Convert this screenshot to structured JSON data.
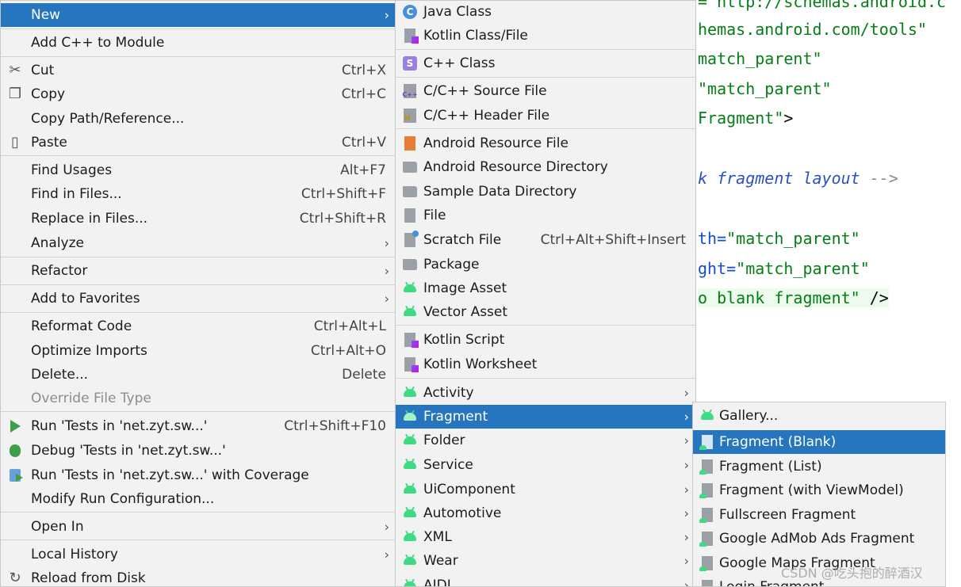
{
  "editor": {
    "lines": [
      {
        "parts": [
          {
            "t": "= http://schemas.android.c",
            "c": "c-str"
          }
        ]
      },
      {
        "parts": [
          {
            "t": "hemas.android.com/tools\"",
            "c": "c-str"
          }
        ]
      },
      {
        "parts": [
          {
            "t": "match_parent\"",
            "c": "c-str"
          }
        ]
      },
      {
        "parts": [
          {
            "t": "\"match_parent\"",
            "c": "c-str"
          }
        ]
      },
      {
        "parts": [
          {
            "t": "Fragment\"",
            "c": "c-str"
          },
          {
            "t": ">",
            "c": "c-plain"
          }
        ]
      },
      {
        "parts": [
          {
            "t": "k fragment layout",
            "c": "c-comi"
          },
          {
            "t": " -->",
            "c": "c-com"
          }
        ]
      },
      {
        "parts": [
          {
            "t": "th=",
            "c": "c-attr"
          },
          {
            "t": "\"match_parent\"",
            "c": "c-str"
          }
        ]
      },
      {
        "parts": [
          {
            "t": "ght=",
            "c": "c-attr"
          },
          {
            "t": "\"match_parent\"",
            "c": "c-str"
          }
        ]
      },
      {
        "parts": [
          {
            "t": "o blank fragment\"",
            "c": "c-str"
          },
          {
            "t": " />",
            "c": "c-plain"
          }
        ]
      }
    ]
  },
  "menu1": {
    "items": [
      {
        "label": "New",
        "shortcut": "",
        "submenu": true,
        "selected": true,
        "icon": ""
      },
      {
        "label": "Add C++ to Module",
        "shortcut": "",
        "submenu": false,
        "icon": ""
      },
      {
        "label": "Cut",
        "shortcut": "Ctrl+X",
        "submenu": false,
        "icon": "scissors-icon"
      },
      {
        "label": "Copy",
        "shortcut": "Ctrl+C",
        "submenu": false,
        "icon": "copy-icon"
      },
      {
        "label": "Copy Path/Reference...",
        "shortcut": "",
        "submenu": false,
        "icon": ""
      },
      {
        "label": "Paste",
        "shortcut": "Ctrl+V",
        "submenu": false,
        "icon": "clipboard-icon"
      },
      {
        "label": "Find Usages",
        "shortcut": "Alt+F7",
        "submenu": false,
        "icon": ""
      },
      {
        "label": "Find in Files...",
        "shortcut": "Ctrl+Shift+F",
        "submenu": false,
        "icon": ""
      },
      {
        "label": "Replace in Files...",
        "shortcut": "Ctrl+Shift+R",
        "submenu": false,
        "icon": ""
      },
      {
        "label": "Analyze",
        "shortcut": "",
        "submenu": true,
        "icon": ""
      },
      {
        "label": "Refactor",
        "shortcut": "",
        "submenu": true,
        "icon": ""
      },
      {
        "label": "Add to Favorites",
        "shortcut": "",
        "submenu": true,
        "icon": ""
      },
      {
        "label": "Reformat Code",
        "shortcut": "Ctrl+Alt+L",
        "submenu": false,
        "icon": ""
      },
      {
        "label": "Optimize Imports",
        "shortcut": "Ctrl+Alt+O",
        "submenu": false,
        "icon": ""
      },
      {
        "label": "Delete...",
        "shortcut": "Delete",
        "submenu": false,
        "icon": ""
      },
      {
        "label": "Override File Type",
        "shortcut": "",
        "submenu": false,
        "disabled": true,
        "icon": ""
      },
      {
        "label": "Run 'Tests in 'net.zyt.sw...'",
        "shortcut": "Ctrl+Shift+F10",
        "submenu": false,
        "icon": "run-icon"
      },
      {
        "label": "Debug 'Tests in 'net.zyt.sw...'",
        "shortcut": "",
        "submenu": false,
        "icon": "debug-icon"
      },
      {
        "label": "Run 'Tests in 'net.zyt.sw...' with Coverage",
        "shortcut": "",
        "submenu": false,
        "icon": "coverage-icon"
      },
      {
        "label": "Modify Run Configuration...",
        "shortcut": "",
        "submenu": false,
        "icon": ""
      },
      {
        "label": "Open In",
        "shortcut": "",
        "submenu": true,
        "icon": ""
      },
      {
        "label": "Local History",
        "shortcut": "",
        "submenu": true,
        "icon": ""
      },
      {
        "label": "Reload from Disk",
        "shortcut": "",
        "submenu": false,
        "icon": "reload-icon"
      }
    ]
  },
  "menu2": {
    "items": [
      {
        "label": "Java Class",
        "shortcut": "",
        "submenu": false,
        "icon": "java-class-icon"
      },
      {
        "label": "Kotlin Class/File",
        "shortcut": "",
        "submenu": false,
        "icon": "kotlin-file-icon"
      },
      {
        "label": "C++ Class",
        "shortcut": "",
        "submenu": false,
        "icon": "cpp-class-icon"
      },
      {
        "label": "C/C++ Source File",
        "shortcut": "",
        "submenu": false,
        "icon": "c-source-icon"
      },
      {
        "label": "C/C++ Header File",
        "shortcut": "",
        "submenu": false,
        "icon": "c-header-icon"
      },
      {
        "label": "Android Resource File",
        "shortcut": "",
        "submenu": false,
        "icon": "resource-file-icon"
      },
      {
        "label": "Android Resource Directory",
        "shortcut": "",
        "submenu": false,
        "icon": "folder-icon"
      },
      {
        "label": "Sample Data Directory",
        "shortcut": "",
        "submenu": false,
        "icon": "folder-icon"
      },
      {
        "label": "File",
        "shortcut": "",
        "submenu": false,
        "icon": "file-icon"
      },
      {
        "label": "Scratch File",
        "shortcut": "Ctrl+Alt+Shift+Insert",
        "submenu": false,
        "icon": "scratch-file-icon"
      },
      {
        "label": "Package",
        "shortcut": "",
        "submenu": false,
        "icon": "package-icon"
      },
      {
        "label": "Image Asset",
        "shortcut": "",
        "submenu": false,
        "icon": "android-icon"
      },
      {
        "label": "Vector Asset",
        "shortcut": "",
        "submenu": false,
        "icon": "android-icon"
      },
      {
        "label": "Kotlin Script",
        "shortcut": "",
        "submenu": false,
        "icon": "kotlin-file-icon"
      },
      {
        "label": "Kotlin Worksheet",
        "shortcut": "",
        "submenu": false,
        "icon": "kotlin-file-icon"
      },
      {
        "label": "Activity",
        "shortcut": "",
        "submenu": true,
        "icon": "android-icon"
      },
      {
        "label": "Fragment",
        "shortcut": "",
        "submenu": true,
        "selected": true,
        "icon": "android-icon"
      },
      {
        "label": "Folder",
        "shortcut": "",
        "submenu": true,
        "icon": "android-icon"
      },
      {
        "label": "Service",
        "shortcut": "",
        "submenu": true,
        "icon": "android-icon"
      },
      {
        "label": "UiComponent",
        "shortcut": "",
        "submenu": true,
        "icon": "android-icon"
      },
      {
        "label": "Automotive",
        "shortcut": "",
        "submenu": true,
        "icon": "android-icon"
      },
      {
        "label": "XML",
        "shortcut": "",
        "submenu": true,
        "icon": "android-icon"
      },
      {
        "label": "Wear",
        "shortcut": "",
        "submenu": true,
        "icon": "android-icon"
      },
      {
        "label": "AIDL",
        "shortcut": "",
        "submenu": true,
        "icon": "android-icon"
      }
    ]
  },
  "menu3": {
    "items": [
      {
        "label": "Gallery...",
        "icon": "android-icon"
      },
      {
        "label": "Fragment (Blank)",
        "selected": true,
        "icon": "fragment-template-icon"
      },
      {
        "label": "Fragment (List)",
        "icon": "fragment-template-icon"
      },
      {
        "label": "Fragment (with ViewModel)",
        "icon": "fragment-template-icon"
      },
      {
        "label": "Fullscreen Fragment",
        "icon": "fragment-template-icon"
      },
      {
        "label": "Google AdMob Ads Fragment",
        "icon": "fragment-template-icon"
      },
      {
        "label": "Google Maps Fragment",
        "icon": "fragment-template-icon"
      },
      {
        "label": "Login Fragment",
        "icon": "fragment-template-icon"
      }
    ]
  },
  "watermark": "CSDN @吃头抱的醉酒汉",
  "colors": {
    "selection": "#2675bf",
    "menu_bg": "#f2f2f2",
    "android_green": "#3ddc84"
  }
}
